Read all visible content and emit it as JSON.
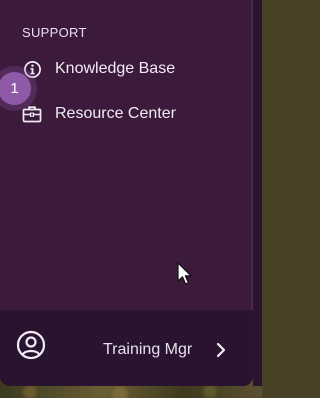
{
  "sidebar": {
    "section_title": "SUPPORT",
    "items": [
      {
        "label": "Knowledge Base",
        "icon": "info-circle-icon"
      },
      {
        "label": "Resource Center",
        "icon": "briefcase-icon"
      }
    ]
  },
  "onboarding": {
    "step_number": "1"
  },
  "footer": {
    "user_name": "Training Mgr",
    "avatar_icon": "user-circle-icon",
    "chevron_icon": "chevron-right-icon"
  },
  "colors": {
    "panel_bg": "#3b1a3c",
    "footer_bg": "#2a1330",
    "badge": "#8e5aa8",
    "text": "#f1ecf2"
  }
}
